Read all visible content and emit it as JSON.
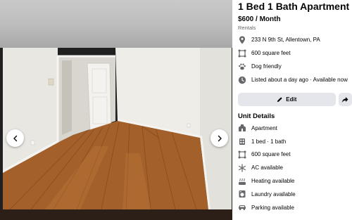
{
  "listing": {
    "title": "1 Bed 1 Bath Apartment",
    "price": "$600 / Month",
    "category": "Rentals"
  },
  "info": [
    {
      "icon": "location-pin-icon",
      "text": "233 N 9th St, Allentown, PA"
    },
    {
      "icon": "square-footage-icon",
      "text": "600 square feet"
    },
    {
      "icon": "paw-icon",
      "text": "Dog friendly"
    },
    {
      "icon": "clock-icon",
      "text": "Listed about a day ago · Available now"
    }
  ],
  "actions": {
    "edit_label": "Edit"
  },
  "unit_details": {
    "heading": "Unit Details",
    "items": [
      {
        "icon": "apartment-icon",
        "text": "Apartment"
      },
      {
        "icon": "bed-bath-icon",
        "text": "1 bed · 1 bath"
      },
      {
        "icon": "square-footage-icon",
        "text": "600 square feet"
      },
      {
        "icon": "snowflake-icon",
        "text": "AC available"
      },
      {
        "icon": "heating-icon",
        "text": "Heating available"
      },
      {
        "icon": "laundry-icon",
        "text": "Laundry available"
      },
      {
        "icon": "car-icon",
        "text": "Parking available"
      }
    ]
  },
  "colors": {
    "button_bg": "#e4e6eb",
    "secondary_text": "#65676b"
  }
}
